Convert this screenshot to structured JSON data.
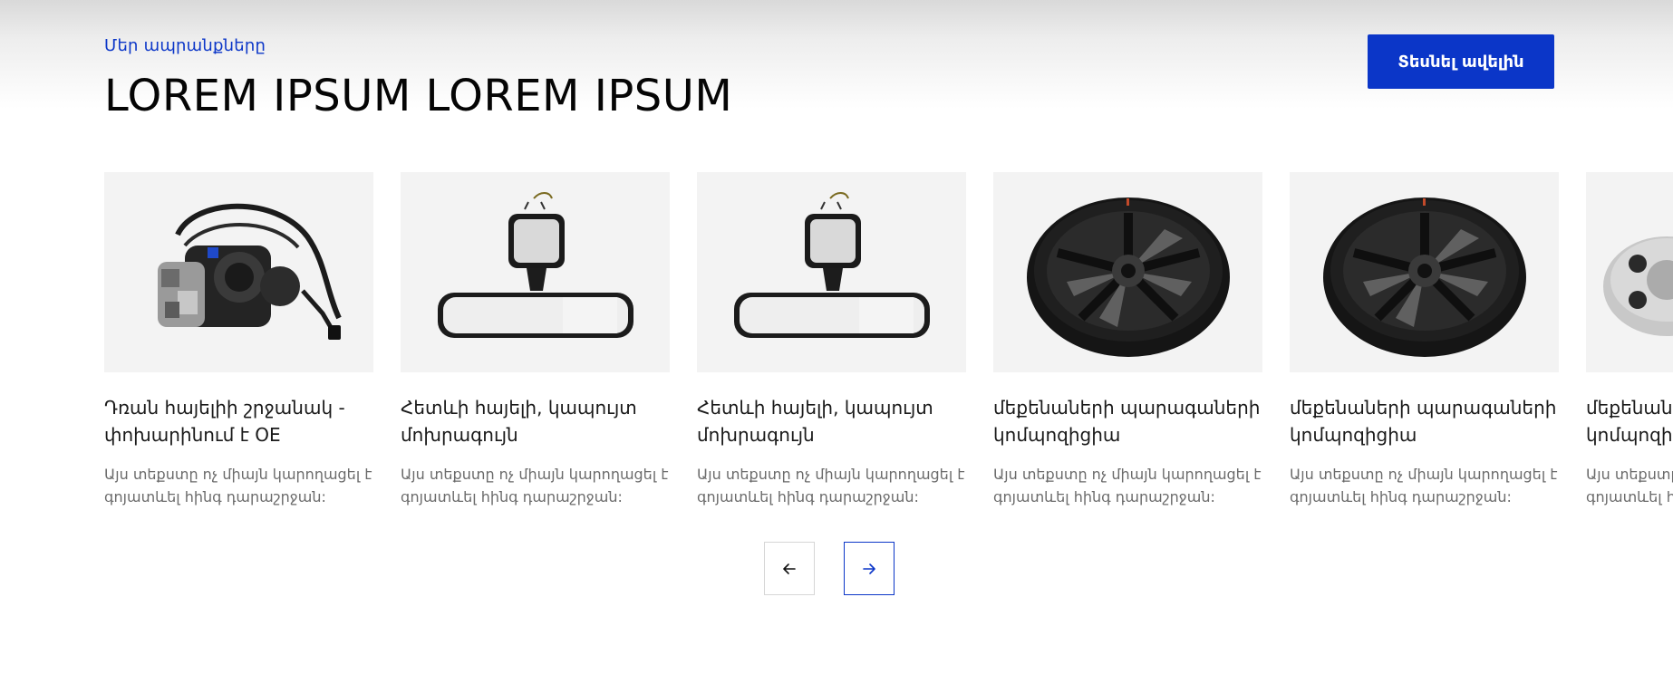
{
  "section": {
    "eyebrow": "Մեր ապրանքները",
    "title": "LOREM IPSUM LOREM IPSUM",
    "cta_label": "Տեսնել ավելին"
  },
  "products": [
    {
      "title": "Դռան հայելիի շրջանակ - փոխարինում է OE",
      "description": "Այս տեքստը ոչ միայն կարողացել է գոյատևել հինգ դարաշրջան:",
      "image": "door-mirror-assembly-image"
    },
    {
      "title": "Հետևի հայելի, կապույտ մոխրագույն",
      "description": "Այս տեքստը ոչ միայն կարողացել է գոյատևել հինգ դարաշրջան:",
      "image": "rearview-mirror-image"
    },
    {
      "title": "Հետևի հայելի, կապույտ մոխրագույն",
      "description": "Այս տեքստը ոչ միայն կարողացել է գոյատևել հինգ դարաշրջան:",
      "image": "rearview-mirror-image"
    },
    {
      "title": "մեքենաների պարագաների կոմպոզիցիա",
      "description": "Այս տեքստը ոչ միայն կարողացել է գոյատևել հինգ դարաշրջան:",
      "image": "alloy-wheel-image"
    },
    {
      "title": "մեքենաների պարագաների կոմպոզիցիա",
      "description": "Այս տեքստը ոչ միայն կարողացել է գոյատևել հինգ դարաշրջան:",
      "image": "alloy-wheel-image"
    },
    {
      "title": "մեքենաների պարագաների կոմպոզիցիա",
      "description": "Այս տեքստը ոչ միայն կարողացել է գոյատևել հինգ դարաշրջան:",
      "image": "wheel-spacer-image"
    }
  ],
  "controls": {
    "prev_icon": "arrow-left-icon",
    "next_icon": "arrow-right-icon"
  },
  "colors": {
    "accent": "#0b36c8",
    "card_background": "#f3f3f3"
  }
}
